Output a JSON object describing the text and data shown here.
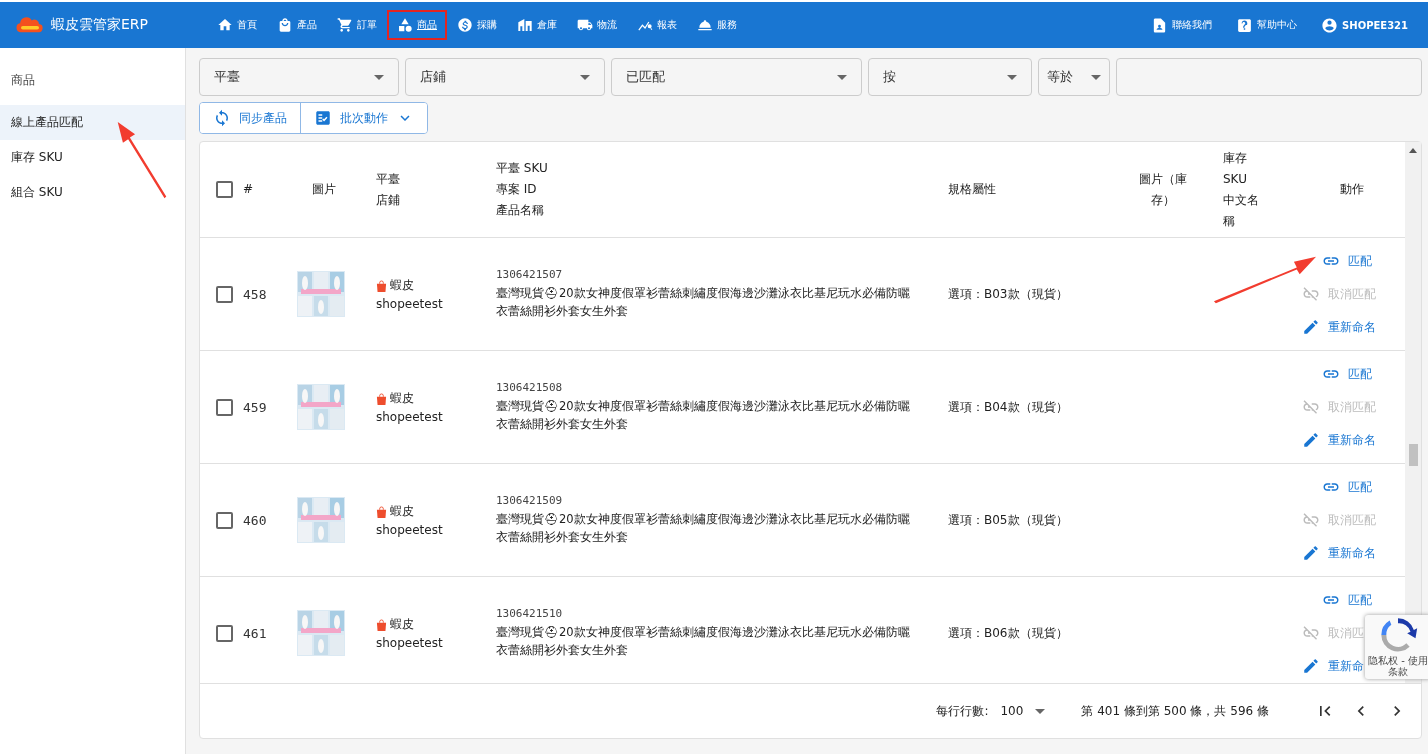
{
  "header": {
    "logo": "蝦皮雲管家ERP",
    "nav": [
      {
        "label": "首頁",
        "kind": "home",
        "selected": false,
        "highlighted": false
      },
      {
        "label": "產品",
        "kind": "bag",
        "selected": false,
        "highlighted": false
      },
      {
        "label": "訂單",
        "kind": "cart",
        "selected": false,
        "highlighted": false
      },
      {
        "label": "商品",
        "kind": "shapes",
        "selected": true,
        "highlighted": true
      },
      {
        "label": "採購",
        "kind": "dollar",
        "selected": false,
        "highlighted": false
      },
      {
        "label": "倉庫",
        "kind": "warehouse",
        "selected": false,
        "highlighted": false
      },
      {
        "label": "物流",
        "kind": "truck",
        "selected": false,
        "highlighted": false
      },
      {
        "label": "報表",
        "kind": "chart",
        "selected": false,
        "highlighted": false
      },
      {
        "label": "服務",
        "kind": "bell",
        "selected": false,
        "highlighted": false
      }
    ],
    "right": [
      {
        "label": "聯絡我們",
        "kind": "contact"
      },
      {
        "label": "幫助中心",
        "kind": "help"
      },
      {
        "label": "SHOPEE321",
        "kind": "account"
      }
    ]
  },
  "sidebar": {
    "title": "商品",
    "items": [
      {
        "label": "線上產品匹配",
        "selected": true
      },
      {
        "label": "庫存 SKU",
        "selected": false
      },
      {
        "label": "組合 SKU",
        "selected": false
      }
    ]
  },
  "filters": [
    {
      "kind": "select",
      "value": "平臺"
    },
    {
      "kind": "select",
      "value": "店鋪"
    },
    {
      "kind": "select",
      "value": "已匹配"
    },
    {
      "kind": "select",
      "value": "按"
    },
    {
      "kind": "small-select",
      "value": "等於"
    },
    {
      "kind": "input"
    }
  ],
  "toolbar": [
    {
      "label": "同步產品",
      "kind": "sync"
    },
    {
      "label": "批次動作",
      "kind": "checklist"
    }
  ],
  "table": {
    "select_all": false,
    "columns": [
      [
        "#"
      ],
      [
        "圖片"
      ],
      [
        "平臺",
        "店鋪"
      ],
      [
        "平臺 SKU",
        "專案 ID",
        "產品名稱"
      ],
      [
        "規格屬性"
      ],
      [
        "圖片（庫存）"
      ],
      [
        "庫存",
        "SKU",
        "中文名稱"
      ],
      [
        "動作"
      ]
    ],
    "rows": [
      {
        "checked": false,
        "number": "458",
        "platform": "蝦皮",
        "store": "shopeetest",
        "sku": "1306421507",
        "name": "臺灣現貨⛑20款女神度假罩衫蕾絲刺繡度假海邊沙灘泳衣比基尼玩水必備防曬衣蕾絲開衫外套女生外套",
        "spec": "選項：B03款（現貨）",
        "actions": [
          {
            "kind": "match",
            "label": "匹配",
            "disabled": false
          },
          {
            "kind": "unmatch",
            "label": "取消匹配",
            "disabled": true
          },
          {
            "kind": "rename",
            "label": "重新命名",
            "disabled": false
          }
        ]
      },
      {
        "checked": false,
        "number": "459",
        "platform": "蝦皮",
        "store": "shopeetest",
        "sku": "1306421508",
        "name": "臺灣現貨⛑20款女神度假罩衫蕾絲刺繡度假海邊沙灘泳衣比基尼玩水必備防曬衣蕾絲開衫外套女生外套",
        "spec": "選項：B04款（現貨）",
        "actions": [
          {
            "kind": "match",
            "label": "匹配",
            "disabled": false
          },
          {
            "kind": "unmatch",
            "label": "取消匹配",
            "disabled": true
          },
          {
            "kind": "rename",
            "label": "重新命名",
            "disabled": false
          }
        ]
      },
      {
        "checked": false,
        "number": "460",
        "platform": "蝦皮",
        "store": "shopeetest",
        "sku": "1306421509",
        "name": "臺灣現貨⛑20款女神度假罩衫蕾絲刺繡度假海邊沙灘泳衣比基尼玩水必備防曬衣蕾絲開衫外套女生外套",
        "spec": "選項：B05款（現貨）",
        "actions": [
          {
            "kind": "match",
            "label": "匹配",
            "disabled": false
          },
          {
            "kind": "unmatch",
            "label": "取消匹配",
            "disabled": true
          },
          {
            "kind": "rename",
            "label": "重新命名",
            "disabled": false
          }
        ]
      },
      {
        "checked": false,
        "number": "461",
        "platform": "蝦皮",
        "store": "shopeetest",
        "sku": "1306421510",
        "name": "臺灣現貨⛑20款女神度假罩衫蕾絲刺繡度假海邊沙灘泳衣比基尼玩水必備防曬衣蕾絲開衫外套女生外套",
        "spec": "選項：B06款（現貨）",
        "actions": [
          {
            "kind": "match",
            "label": "匹配",
            "disabled": false
          },
          {
            "kind": "unmatch",
            "label": "取消匹",
            "disabled": true
          },
          {
            "kind": "rename",
            "label": "重新命",
            "disabled": false
          }
        ]
      }
    ]
  },
  "pagination": {
    "rows_per_page_label": "每行行數:",
    "rows_per_page": "100",
    "range": "第 401 條到第 500 條，共 596 條"
  },
  "recaptcha": {
    "text": "隐私权 - 使用条款"
  }
}
